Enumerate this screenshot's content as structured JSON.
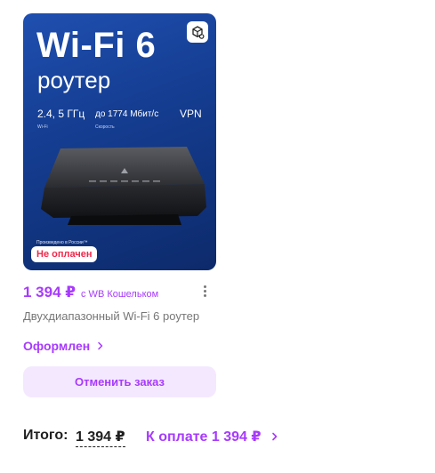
{
  "product": {
    "image": {
      "title_main": "Wi-Fi 6",
      "title_sub": "роутер",
      "spec_freq": "2.4, 5 ГГц",
      "spec_freq_caption": "Wi-Fi",
      "spec_speed": "до 1774 Мбит/с",
      "spec_speed_caption": "Скорость",
      "spec_vpn": "VPN",
      "made_in": "Произведено в России™"
    },
    "status_badge": "Не оплачен",
    "price": "1 394 ₽",
    "wallet_note": "с WB Кошельком",
    "name": "Двухдиапазонный Wi-Fi 6 роутер",
    "order_status": "Оформлен",
    "cancel_label": "Отменить заказ"
  },
  "summary": {
    "total_label": "Итого:",
    "total_value": "1 394 ₽",
    "pay_label": "К оплате 1 394 ₽"
  },
  "icons": {
    "ar": "ar-cube-icon",
    "more": "kebab-menu-icon",
    "chevron": "chevron-right-icon"
  },
  "colors": {
    "accent": "#a73afd",
    "accent_soft": "#f4e8ff",
    "alert": "#f0284a"
  }
}
